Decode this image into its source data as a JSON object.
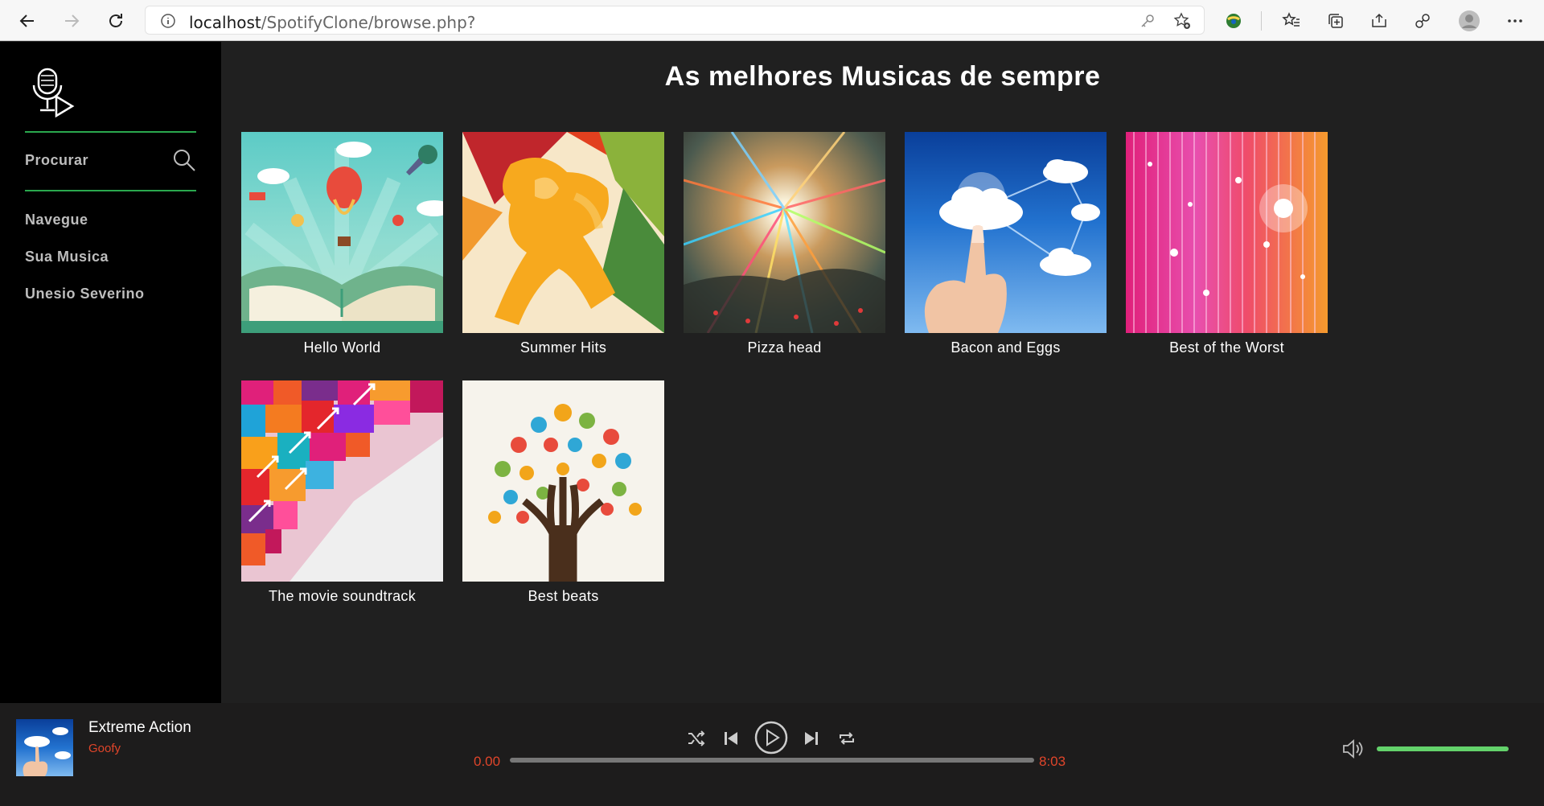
{
  "browser": {
    "url_host": "localhost",
    "url_path": "/SpotifyClone/browse.php?"
  },
  "sidebar": {
    "search_label": "Procurar",
    "items": [
      {
        "label": "Navegue"
      },
      {
        "label": "Sua Musica"
      },
      {
        "label": "Unesio Severino"
      }
    ]
  },
  "main": {
    "title": "As melhores Musicas de sempre",
    "albums": [
      {
        "title": "Hello World"
      },
      {
        "title": "Summer Hits"
      },
      {
        "title": "Pizza head"
      },
      {
        "title": "Bacon and Eggs"
      },
      {
        "title": "Best of the Worst"
      },
      {
        "title": "The movie soundtrack"
      },
      {
        "title": "Best beats"
      }
    ]
  },
  "player": {
    "track_title": "Extreme Action",
    "artist": "Goofy",
    "time_current": "0.00",
    "time_total": "8:03",
    "progress": 0,
    "volume": 1.0,
    "controls": [
      "shuffle-icon",
      "previous-icon",
      "play-icon",
      "next-icon",
      "repeat-icon"
    ]
  },
  "colors": {
    "accent_green": "#2aa84e",
    "time_red": "#e0452a",
    "volume_green": "#63d26b"
  }
}
